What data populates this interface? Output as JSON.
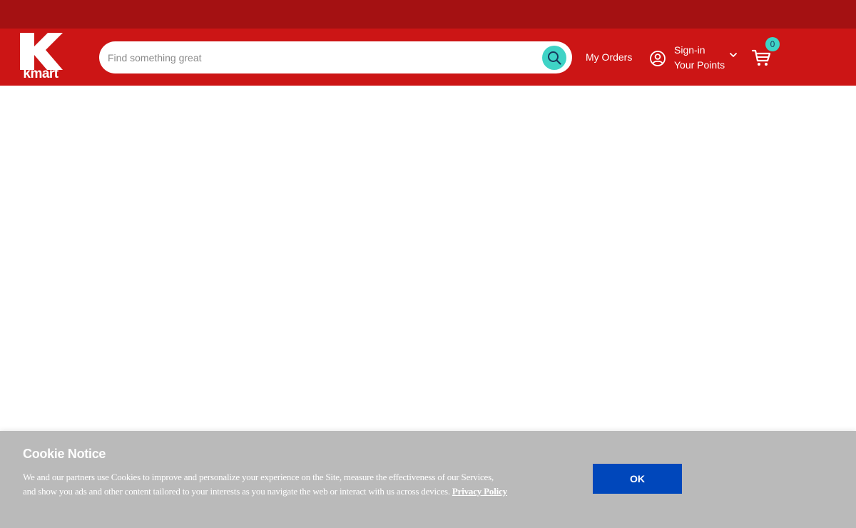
{
  "brand": {
    "name": "kmart",
    "logo_icon": "kmart-k-logo",
    "colors": {
      "top_bar": "#a41112",
      "header": "#cc1515",
      "accent": "#3fd3c6",
      "ok_button": "#0047bb",
      "cookie_bg": "#bababa"
    }
  },
  "search": {
    "placeholder": "Find something great",
    "value": "",
    "icon": "search-icon"
  },
  "nav": {
    "my_orders": "My Orders",
    "account_icon": "user-circle-icon",
    "sign_in": "Sign-in",
    "points": "Your Points",
    "dropdown_icon": "chevron-down-icon",
    "cart_icon": "cart-icon",
    "cart_count": "0"
  },
  "cookie_notice": {
    "title": "Cookie Notice",
    "body": "We and our partners use Cookies to improve and personalize your experience on the Site, measure the effectiveness of our Services, and show you ads and other content tailored to your interests as you navigate the web or interact with us across devices.",
    "link": "Privacy Policy",
    "ok_label": "OK"
  }
}
